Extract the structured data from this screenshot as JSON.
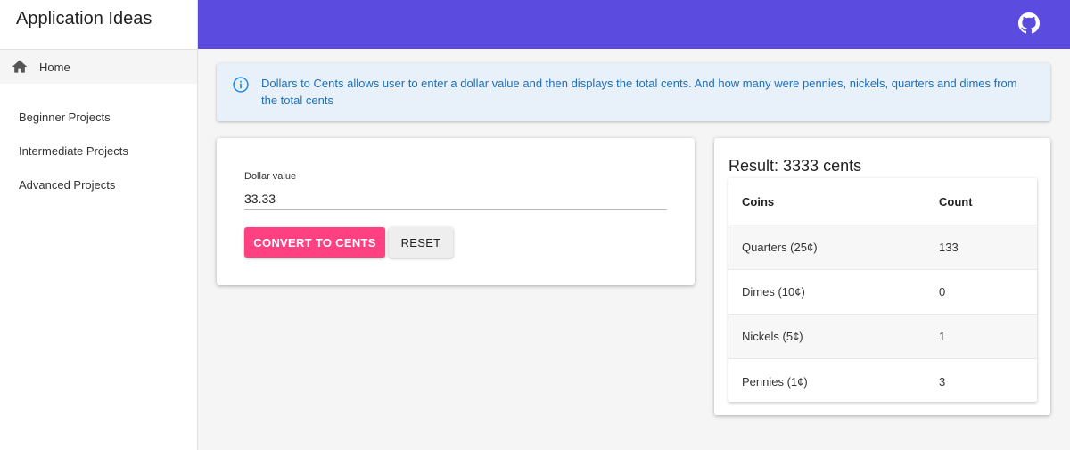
{
  "app": {
    "title": "Application Ideas"
  },
  "sidebar": {
    "home": {
      "label": "Home",
      "icon": "home-icon"
    },
    "items": [
      {
        "label": "Beginner Projects"
      },
      {
        "label": "Intermediate Projects"
      },
      {
        "label": "Advanced Projects"
      }
    ]
  },
  "header": {
    "color": "#5b4cdf",
    "icon": "github-icon"
  },
  "alert": {
    "icon": "info-icon",
    "text": "Dollars to Cents allows user to enter a dollar value and then displays the total cents. And how many were pennies, nickels, quarters and dimes from the total cents"
  },
  "form": {
    "label": "Dollar value",
    "value": "33.33",
    "convert_label": "CONVERT TO CENTS",
    "reset_label": "RESET",
    "accent": "#ff4081"
  },
  "result": {
    "title": "Result: 3333 cents",
    "columns": [
      "Coins",
      "Count"
    ],
    "rows": [
      {
        "coin": "Quarters (25¢)",
        "count": "133"
      },
      {
        "coin": "Dimes (10¢)",
        "count": "0"
      },
      {
        "coin": "Nickels (5¢)",
        "count": "1"
      },
      {
        "coin": "Pennies (1¢)",
        "count": "3"
      }
    ]
  }
}
